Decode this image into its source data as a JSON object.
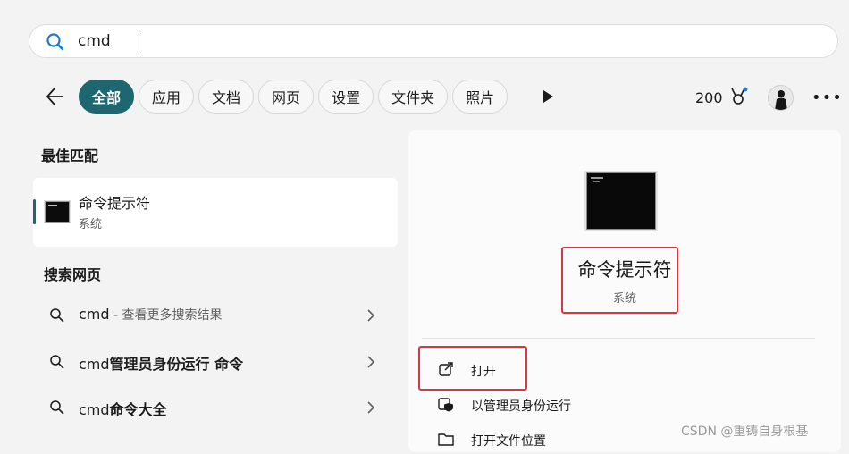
{
  "search": {
    "query": "cmd"
  },
  "filters": [
    {
      "label": "全部",
      "active": true
    },
    {
      "label": "应用"
    },
    {
      "label": "文档"
    },
    {
      "label": "网页"
    },
    {
      "label": "设置"
    },
    {
      "label": "文件夹"
    },
    {
      "label": "照片"
    }
  ],
  "toolbar": {
    "points": "200"
  },
  "best_match": {
    "heading": "最佳匹配",
    "title": "命令提示符",
    "subtitle": "系统"
  },
  "web_search": {
    "heading": "搜索网页",
    "items": [
      {
        "query": "cmd",
        "suffix": " - 查看更多搜索结果"
      },
      {
        "query": "cmd",
        "suffix": "管理员身份运行 命令"
      },
      {
        "query": "cmd",
        "suffix": "命令大全"
      }
    ]
  },
  "details": {
    "title": "命令提示符",
    "subtitle": "系统",
    "actions": [
      {
        "label": "打开",
        "icon": "open-external-icon"
      },
      {
        "label": "以管理员身份运行",
        "icon": "shield-admin-icon"
      },
      {
        "label": "打开文件位置",
        "icon": "folder-icon"
      }
    ]
  },
  "watermark": "CSDN @重铸自身根基",
  "colors": {
    "accent": "#1e6670",
    "highlight": "#d9363e"
  }
}
